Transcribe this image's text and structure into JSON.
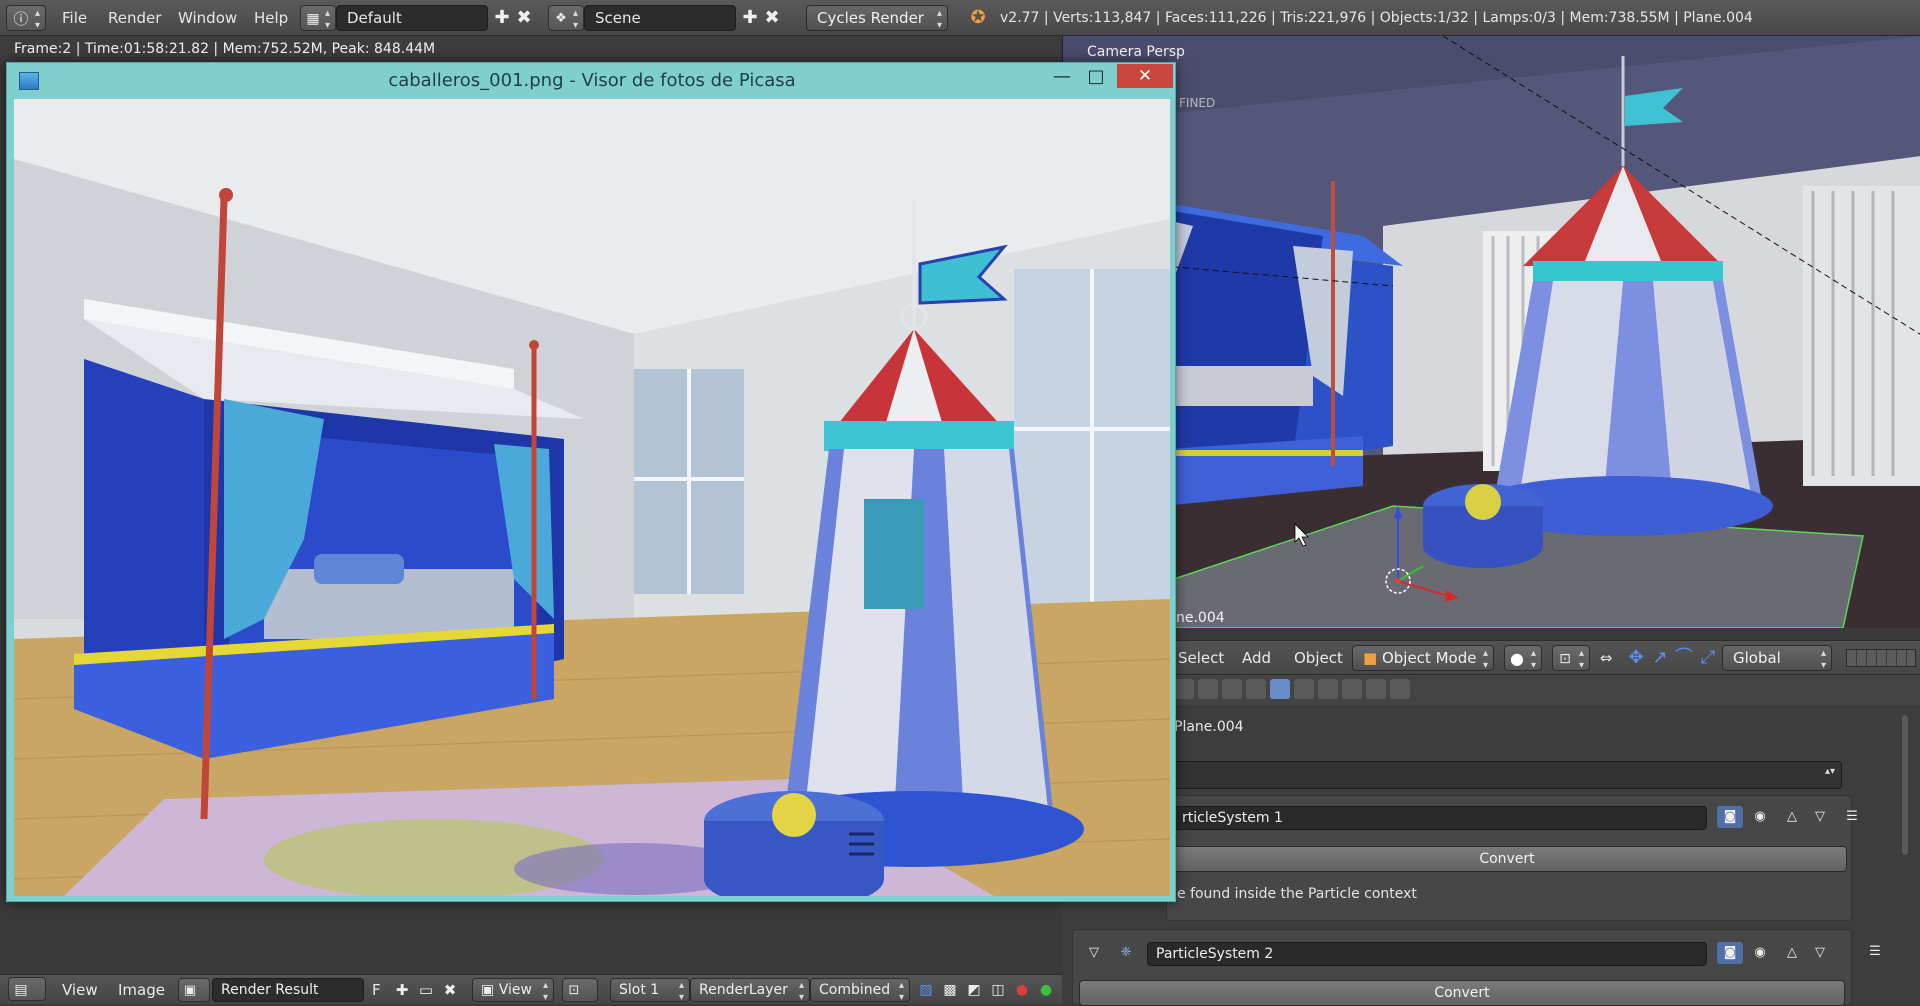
{
  "topbar": {
    "menu": [
      "File",
      "Render",
      "Window",
      "Help"
    ],
    "screen_layout": "Default",
    "scene": "Scene",
    "render_engine": "Cycles Render",
    "stats": "v2.77 | Verts:113,847 | Faces:111,226 | Tris:221,976 | Objects:1/32 | Lamps:0/3 | Mem:738.55M | Plane.004"
  },
  "render_info": "Frame:2 | Time:01:58:21.82 | Mem:752.52M, Peak: 848.44M",
  "picasa": {
    "title": "caballeros_001.png - Visor de fotos de Picasa",
    "minimize": "—",
    "maximize": "□",
    "close": "✕"
  },
  "viewport": {
    "label": "Camera Persp",
    "overlay_text": "FINED",
    "object_label": "ne.004",
    "header": {
      "select": "Select",
      "add": "Add",
      "object": "Object",
      "mode": "Object Mode",
      "orientation": "Global"
    }
  },
  "properties": {
    "object_name": "Plane.004",
    "particle_system_1": "rticleSystem 1",
    "convert_1": "Convert",
    "context_note": "e found inside the Particle context",
    "particle_system_2": "ParticleSystem 2",
    "convert_2": "Convert"
  },
  "bottombar": {
    "view": "View",
    "image": "Image",
    "image_name": "Render Result",
    "fake_user": "F",
    "view2": "View",
    "slot": "Slot 1",
    "render_layer": "RenderLayer",
    "pass": "Combined"
  },
  "colors": {
    "picasa_frame": "#7fcfcf",
    "close_red": "#c9463d",
    "blender_bg": "#3a3a3a",
    "field_dark": "#2a2a2a"
  }
}
